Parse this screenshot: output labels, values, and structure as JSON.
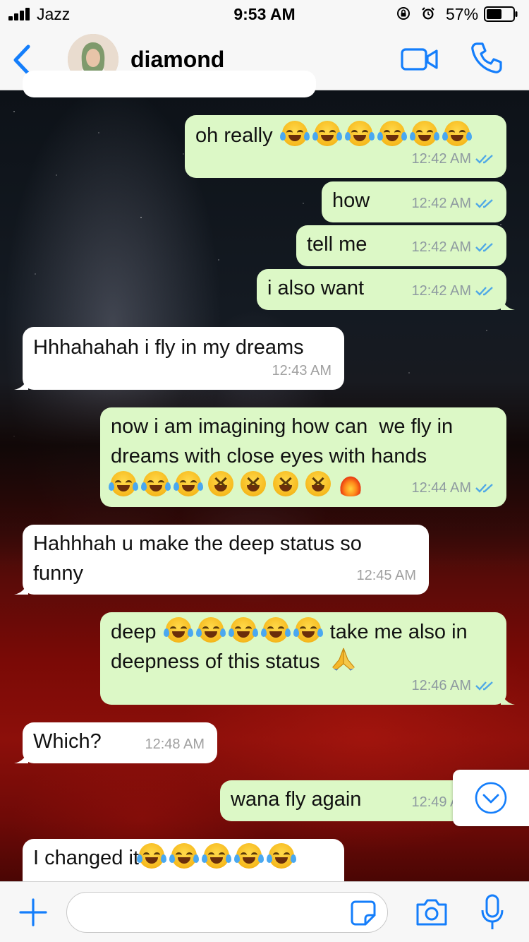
{
  "status_bar": {
    "carrier": "Jazz",
    "time": "9:53 AM",
    "battery_percent": "57%"
  },
  "header": {
    "contact_name": "diamond",
    "back_icon": "chevron-left-icon",
    "video_icon": "video-camera-icon",
    "call_icon": "phone-icon"
  },
  "colors": {
    "accent": "#147efb",
    "sent_bubble": "#dcf8c6",
    "received_bubble": "#ffffff",
    "read_ticks": "#4fa8e6"
  },
  "messages": [
    {
      "direction": "sent",
      "text": "oh really",
      "emoji": [
        "joy",
        "joy",
        "joy",
        "joy",
        "joy",
        "joy"
      ],
      "time": "12:42 AM",
      "read": true
    },
    {
      "direction": "sent",
      "text": "how",
      "time": "12:42 AM",
      "read": true
    },
    {
      "direction": "sent",
      "text": "tell me",
      "time": "12:42 AM",
      "read": true
    },
    {
      "direction": "sent",
      "text": "i also want",
      "time": "12:42 AM",
      "read": true
    },
    {
      "direction": "received",
      "text": "Hhhahahah i fly in my dreams",
      "time": "12:43 AM"
    },
    {
      "direction": "sent",
      "text": "now i am imagining how can  we fly in dreams with close eyes with hands",
      "emoji": [
        "joy",
        "joy",
        "joy",
        "grin",
        "grin",
        "grin",
        "grin",
        "fire"
      ],
      "time": "12:44 AM",
      "read": true
    },
    {
      "direction": "received",
      "text": "Hahhhah u make the deep status so funny",
      "time": "12:45 AM"
    },
    {
      "direction": "sent",
      "text_before": "deep",
      "emoji": [
        "joy",
        "joy",
        "joy",
        "joy",
        "joy"
      ],
      "text_after": "take me also in deepness of this status",
      "trailing_emoji": "pray",
      "time": "12:46 AM",
      "read": true
    },
    {
      "direction": "received",
      "text": "Which?",
      "time": "12:48 AM"
    },
    {
      "direction": "sent",
      "text": "wana fly again",
      "time": "12:49 AM",
      "read": true
    },
    {
      "direction": "received",
      "text": "I changed it",
      "emoji": [
        "joy",
        "joy",
        "joy",
        "joy",
        "joy"
      ]
    }
  ],
  "input": {
    "placeholder": "",
    "value": ""
  },
  "icons": {
    "attach": "plus-icon",
    "sticker": "sticker-icon",
    "camera": "camera-icon",
    "mic": "microphone-icon",
    "scroll_down": "chevron-down-circle-icon"
  }
}
